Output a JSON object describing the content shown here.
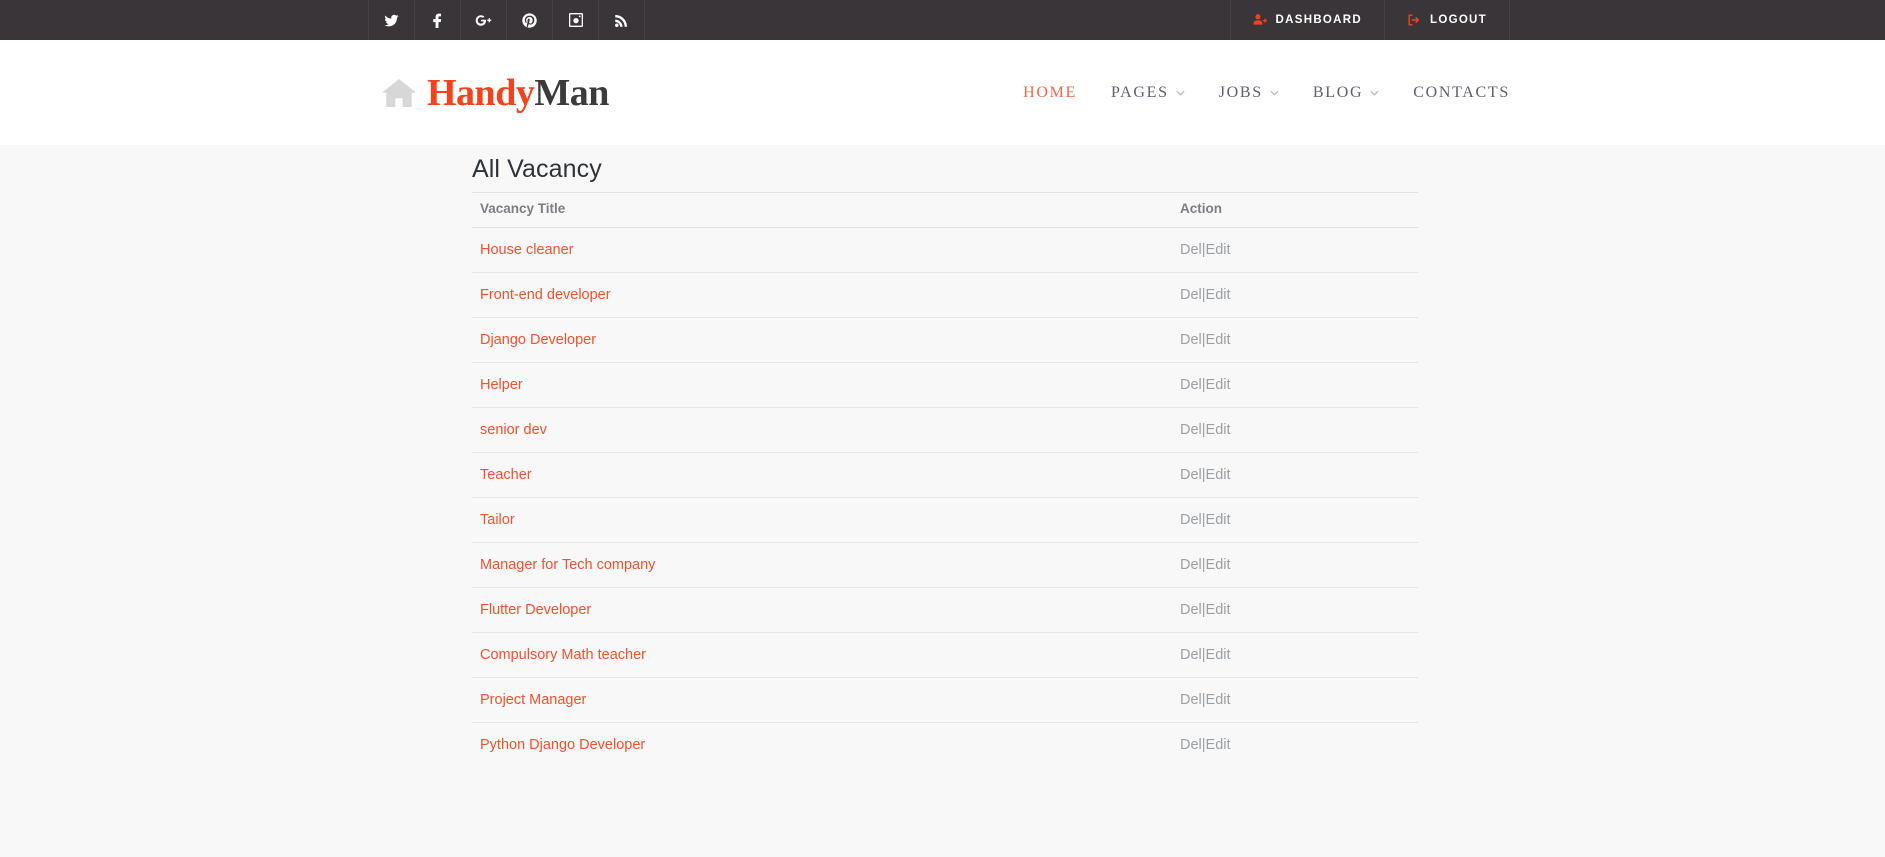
{
  "topbar": {
    "social": [
      {
        "name": "twitter-icon",
        "label": "Twitter"
      },
      {
        "name": "facebook-icon",
        "label": "Facebook"
      },
      {
        "name": "google-plus-icon",
        "label": "Google Plus"
      },
      {
        "name": "pinterest-icon",
        "label": "Pinterest"
      },
      {
        "name": "instagram-icon",
        "label": "Instagram"
      },
      {
        "name": "rss-icon",
        "label": "RSS"
      }
    ],
    "account": {
      "dashboard_label": "DASHBOARD",
      "logout_label": "LOGOUT"
    }
  },
  "header": {
    "logo": {
      "icon": "home-icon",
      "text_primary": "Handy",
      "text_secondary": "Man"
    },
    "nav": [
      {
        "label": "HOME",
        "has_caret": false,
        "active": true
      },
      {
        "label": "PAGES",
        "has_caret": true,
        "active": false
      },
      {
        "label": "JOBS",
        "has_caret": true,
        "active": false
      },
      {
        "label": "BLOG",
        "has_caret": true,
        "active": false
      },
      {
        "label": "CONTACTS",
        "has_caret": false,
        "active": false
      }
    ]
  },
  "main": {
    "page_title": "All Vacancy",
    "table": {
      "columns": [
        "Vacancy Title",
        "Action"
      ],
      "action_delete_label": "Del",
      "action_separator": "|",
      "action_edit_label": "Edit",
      "rows": [
        {
          "title": "House cleaner"
        },
        {
          "title": "Front-end developer"
        },
        {
          "title": "Django Developer"
        },
        {
          "title": "Helper"
        },
        {
          "title": "senior dev"
        },
        {
          "title": "Teacher"
        },
        {
          "title": "Tailor"
        },
        {
          "title": "Manager for Tech company"
        },
        {
          "title": "Flutter Developer"
        },
        {
          "title": "Compulsory Math teacher"
        },
        {
          "title": "Project Manager"
        },
        {
          "title": "Python Django Developer"
        }
      ]
    }
  },
  "colors": {
    "accent": "#f4512c",
    "topbar_bg": "#3a3538",
    "page_bg": "#f8f8f8",
    "header_bg": "#ffffff",
    "nav_text": "#5b6170",
    "muted_text": "#9aa0a6"
  }
}
